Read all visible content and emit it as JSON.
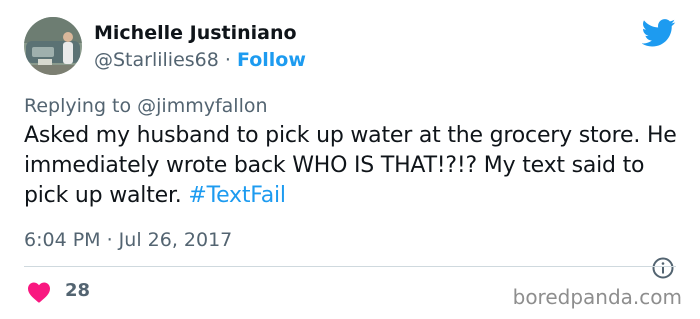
{
  "user": {
    "name": "Michelle Justiniano",
    "handle": "@Starlilies68",
    "separator": " · ",
    "follow_label": "Follow"
  },
  "reply": {
    "prefix": "Replying to ",
    "mention": "@jimmyfallon"
  },
  "tweet": {
    "text": "Asked my husband to pick up water at the grocery store. He immediately wrote back WHO IS THAT!?!? My text said to pick up walter. ",
    "hashtag": "#TextFail",
    "timestamp": "6:04 PM · Jul 26, 2017",
    "likes": "28"
  },
  "watermark": "boredpanda.com",
  "icons": {
    "brand": "twitter-bird-icon",
    "info": "info-icon",
    "like": "heart-icon"
  },
  "colors": {
    "accent": "#1d9bf0",
    "text": "#0f1419",
    "muted": "#536471",
    "heart": "#f91880"
  }
}
